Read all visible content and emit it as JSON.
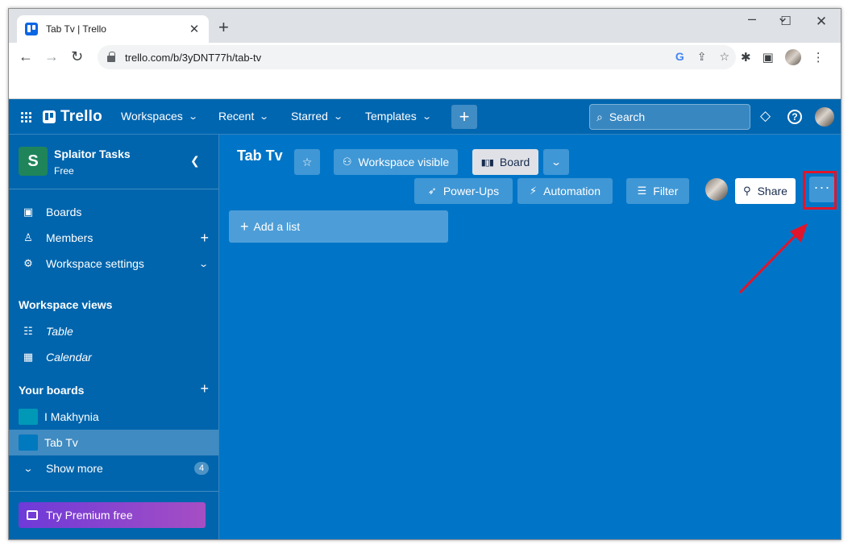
{
  "browser": {
    "tab_title": "Tab Tv | Trello",
    "tab_close": "✕",
    "new_tab": "+",
    "url": "trello.com/b/3yDNT77h/tab-tv",
    "window_controls": {
      "minimize": "⌄",
      "maximize": "☐",
      "close": "✕"
    }
  },
  "header": {
    "logo": "Trello",
    "nav": [
      {
        "label": "Workspaces"
      },
      {
        "label": "Recent"
      },
      {
        "label": "Starred"
      },
      {
        "label": "Templates"
      }
    ],
    "create": "+",
    "search_placeholder": "Search"
  },
  "sidebar": {
    "workspace_initial": "S",
    "workspace_name": "Splaitor Tasks",
    "workspace_plan": "Free",
    "items": [
      {
        "label": "Boards"
      },
      {
        "label": "Members"
      },
      {
        "label": "Workspace settings"
      }
    ],
    "views_title": "Workspace views",
    "views": [
      {
        "label": "Table"
      },
      {
        "label": "Calendar"
      }
    ],
    "boards_title": "Your boards",
    "boards": [
      {
        "label": "I Makhynia",
        "color": "#0098b7"
      },
      {
        "label": "Tab Tv",
        "color": "#0079bf"
      }
    ],
    "show_more": "Show more",
    "show_more_count": "4",
    "premium": "Try Premium free"
  },
  "board": {
    "title": "Tab Tv",
    "visibility": "Workspace visible",
    "view": "Board",
    "power_ups": "Power-Ups",
    "automation": "Automation",
    "filter": "Filter",
    "share": "Share",
    "more": "···",
    "add_list": "Add a list"
  },
  "colors": {
    "header": "#0066b0",
    "sidebar": "#0065ad",
    "board_bg": "#0075c7",
    "highlight": "#e0152b",
    "premium_start": "#6e3ad8",
    "premium_end": "#a64ec4"
  }
}
